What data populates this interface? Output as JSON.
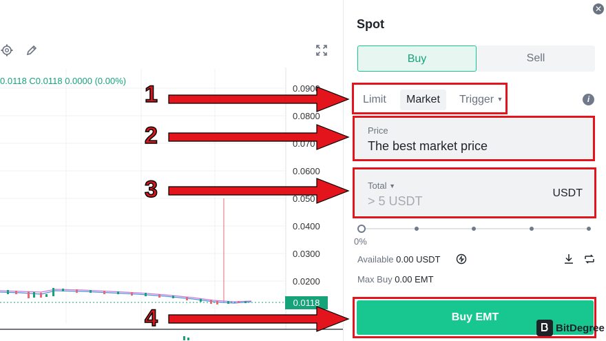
{
  "chart": {
    "ohlc_text": "0.0118  C0.0118  0.0000 (0.00%)",
    "price_axis": [
      "0.0900",
      "0.0800",
      "0.070",
      "0.0600",
      "0.050",
      "0.0400",
      "0.0300",
      "0.0200"
    ],
    "last_price": "0.0118",
    "icons": [
      "settings-icon",
      "pencil-icon",
      "fullscreen-icon"
    ]
  },
  "panel": {
    "title": "Spot",
    "buy_tab": "Buy",
    "sell_tab": "Sell",
    "order_types": {
      "limit": "Limit",
      "market": "Market",
      "trigger": "Trigger"
    },
    "price_label": "Price",
    "price_value": "The best market price",
    "total_label": "Total",
    "total_placeholder": "> 5 USDT",
    "total_unit": "USDT",
    "slider_percent": "0%",
    "available_label": "Available",
    "available_value": "0.00 USDT",
    "max_buy_label": "Max Buy",
    "max_buy_value": "0.00 EMT",
    "buy_button": "Buy EMT"
  },
  "annotations": {
    "steps": [
      "1",
      "2",
      "3",
      "4"
    ],
    "color": "#e3141b"
  },
  "watermark": {
    "text": "BitDegree"
  },
  "colors": {
    "accent": "#17c78f",
    "up": "#16a37a"
  }
}
